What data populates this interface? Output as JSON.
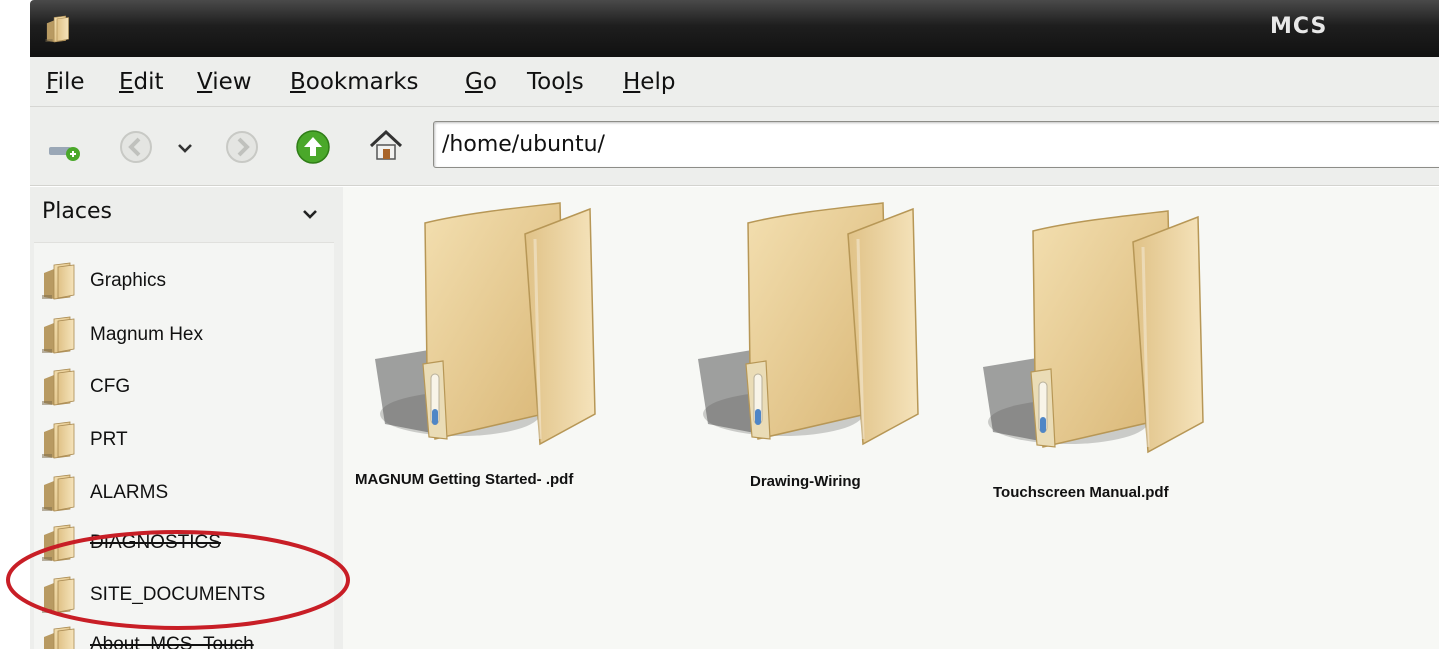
{
  "window": {
    "title": "MCS",
    "app_icon": "folder-icon"
  },
  "menubar": {
    "items": [
      {
        "label": "File",
        "mnemonic": "F"
      },
      {
        "label": "Edit",
        "mnemonic": "E"
      },
      {
        "label": "View",
        "mnemonic": "V"
      },
      {
        "label": "Bookmarks",
        "mnemonic": "B"
      },
      {
        "label": "Go",
        "mnemonic": "G"
      },
      {
        "label": "Tools",
        "mnemonic": "l"
      },
      {
        "label": "Help",
        "mnemonic": "H"
      }
    ]
  },
  "toolbar": {
    "buttons": [
      {
        "name": "new-tab",
        "icon": "new-tab-icon",
        "enabled": false
      },
      {
        "name": "back",
        "icon": "back-arrow-icon",
        "enabled": false
      },
      {
        "name": "history",
        "icon": "chevron-down-icon",
        "enabled": true
      },
      {
        "name": "forward",
        "icon": "forward-arrow-icon",
        "enabled": false
      },
      {
        "name": "up",
        "icon": "up-arrow-icon",
        "enabled": true
      },
      {
        "name": "home",
        "icon": "home-icon",
        "enabled": true
      }
    ],
    "path": "/home/ubuntu/"
  },
  "sidebar": {
    "header": "Places",
    "items": [
      {
        "label": "Graphics",
        "icon": "folder-icon"
      },
      {
        "label": "Magnum Hex",
        "icon": "folder-icon"
      },
      {
        "label": "CFG",
        "icon": "folder-icon"
      },
      {
        "label": "PRT",
        "icon": "folder-icon"
      },
      {
        "label": "ALARMS",
        "icon": "folder-icon"
      },
      {
        "label": "DIAGNOSTICS",
        "icon": "folder-icon"
      },
      {
        "label": "SITE_DOCUMENTS",
        "icon": "folder-icon"
      },
      {
        "label": "About_MCS_Touch",
        "icon": "folder-icon"
      }
    ]
  },
  "main": {
    "files": [
      {
        "name": "MAGNUM Getting Started- .pdf",
        "icon": "folder-icon"
      },
      {
        "name": "Drawing-Wiring",
        "icon": "folder-icon"
      },
      {
        "name": "Touchscreen Manual.pdf",
        "icon": "folder-icon"
      }
    ]
  },
  "colors": {
    "annotation_circle": "#c81e26",
    "up_button": "#4aa82a",
    "folder": "#e6c98e"
  }
}
